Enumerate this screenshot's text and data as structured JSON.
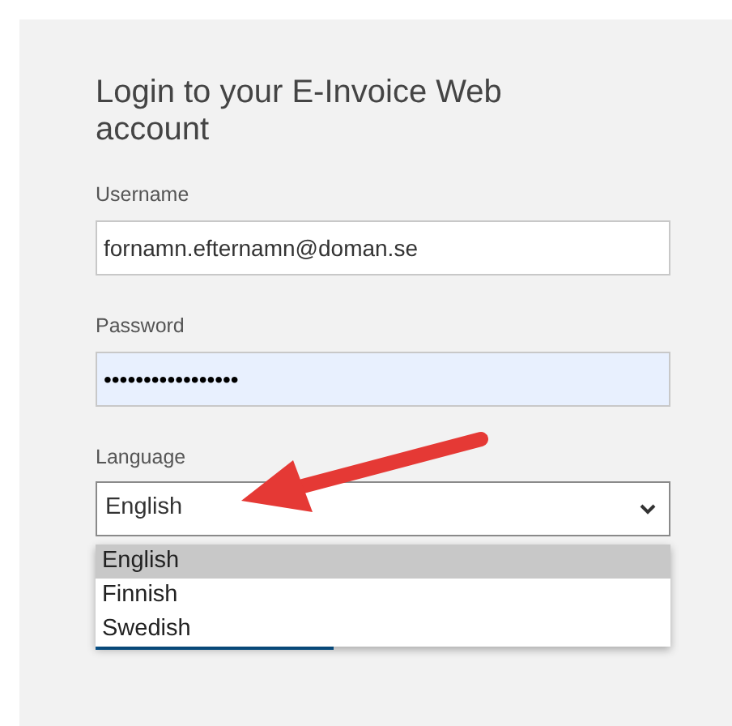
{
  "title": "Login to your E-Invoice Web account",
  "fields": [
    {
      "label": "Username",
      "value": "fornamn.efternamn@doman.se",
      "autofilled": false
    },
    {
      "label": "Password",
      "value": "•••••••••••••••••",
      "autofilled": true
    }
  ],
  "language": {
    "label": "Language",
    "value": "English",
    "expanded": true,
    "options": [
      {
        "label": "English",
        "selected": true
      },
      {
        "label": "Finnish",
        "selected": false
      },
      {
        "label": "Swedish",
        "selected": false
      }
    ]
  }
}
